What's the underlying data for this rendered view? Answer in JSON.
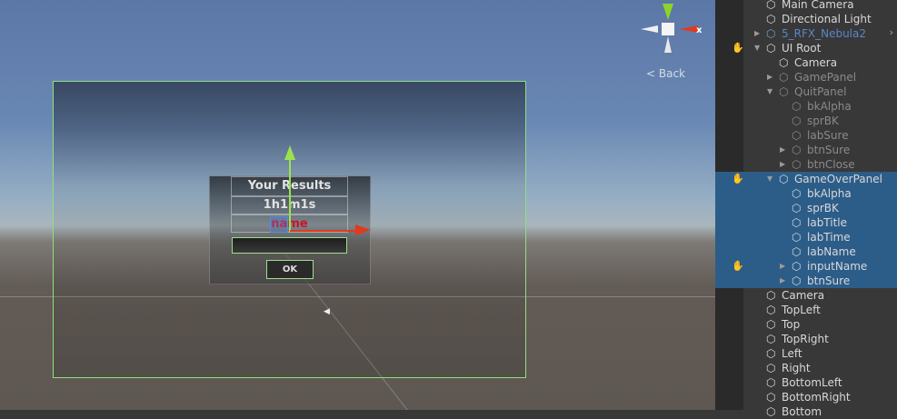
{
  "scene": {
    "panel": {
      "title": "Your Results",
      "time": "1h1m1s",
      "name": "name",
      "ok_label": "OK"
    },
    "gizmo": {
      "x_label": "x",
      "back_label": "< Back"
    },
    "colors": {
      "y_axis": "#9be34d",
      "x_axis": "#e23a1c",
      "canvas_border": "#8fe07a",
      "selection": "#2c5d89"
    }
  },
  "hierarchy": {
    "rows": [
      {
        "label": "Main Camera",
        "level": 0
      },
      {
        "label": "Directional Light",
        "level": 0
      },
      {
        "label": "5_RFX_Nebula2",
        "level": 0,
        "arrow": true,
        "prefab": true
      },
      {
        "label": "UI Root",
        "level": 0,
        "arrow": true,
        "open": true
      },
      {
        "label": "Camera",
        "level": 1
      },
      {
        "label": "GamePanel",
        "level": 1,
        "arrow": true,
        "dim": true
      },
      {
        "label": "QuitPanel",
        "level": 1,
        "arrow": true,
        "open": true,
        "dim": true
      },
      {
        "label": "bkAlpha",
        "level": 2,
        "dim": true
      },
      {
        "label": "sprBK",
        "level": 2,
        "dim": true
      },
      {
        "label": "labSure",
        "level": 2,
        "dim": true
      },
      {
        "label": "btnSure",
        "level": 2,
        "arrow": true,
        "dim": true
      },
      {
        "label": "btnClose",
        "level": 2,
        "arrow": true,
        "dim": true
      },
      {
        "label": "GameOverPanel",
        "level": 1,
        "arrow": true,
        "open": true,
        "selected": true
      },
      {
        "label": "bkAlpha",
        "level": 2,
        "selected": true
      },
      {
        "label": "sprBK",
        "level": 2,
        "selected": true
      },
      {
        "label": "labTitle",
        "level": 2,
        "selected": true
      },
      {
        "label": "labTime",
        "level": 2,
        "selected": true
      },
      {
        "label": "labName",
        "level": 2,
        "selected": true
      },
      {
        "label": "inputName",
        "level": 2,
        "arrow": true,
        "selected": true
      },
      {
        "label": "btnSure",
        "level": 2,
        "arrow": true,
        "selected": true
      },
      {
        "label": "Camera",
        "level": 0
      },
      {
        "label": "TopLeft",
        "level": 0
      },
      {
        "label": "Top",
        "level": 0
      },
      {
        "label": "TopRight",
        "level": 0
      },
      {
        "label": "Left",
        "level": 0
      },
      {
        "label": "Right",
        "level": 0
      },
      {
        "label": "BottomLeft",
        "level": 0
      },
      {
        "label": "BottomRight",
        "level": 0
      },
      {
        "label": "Bottom",
        "level": 0
      }
    ]
  }
}
